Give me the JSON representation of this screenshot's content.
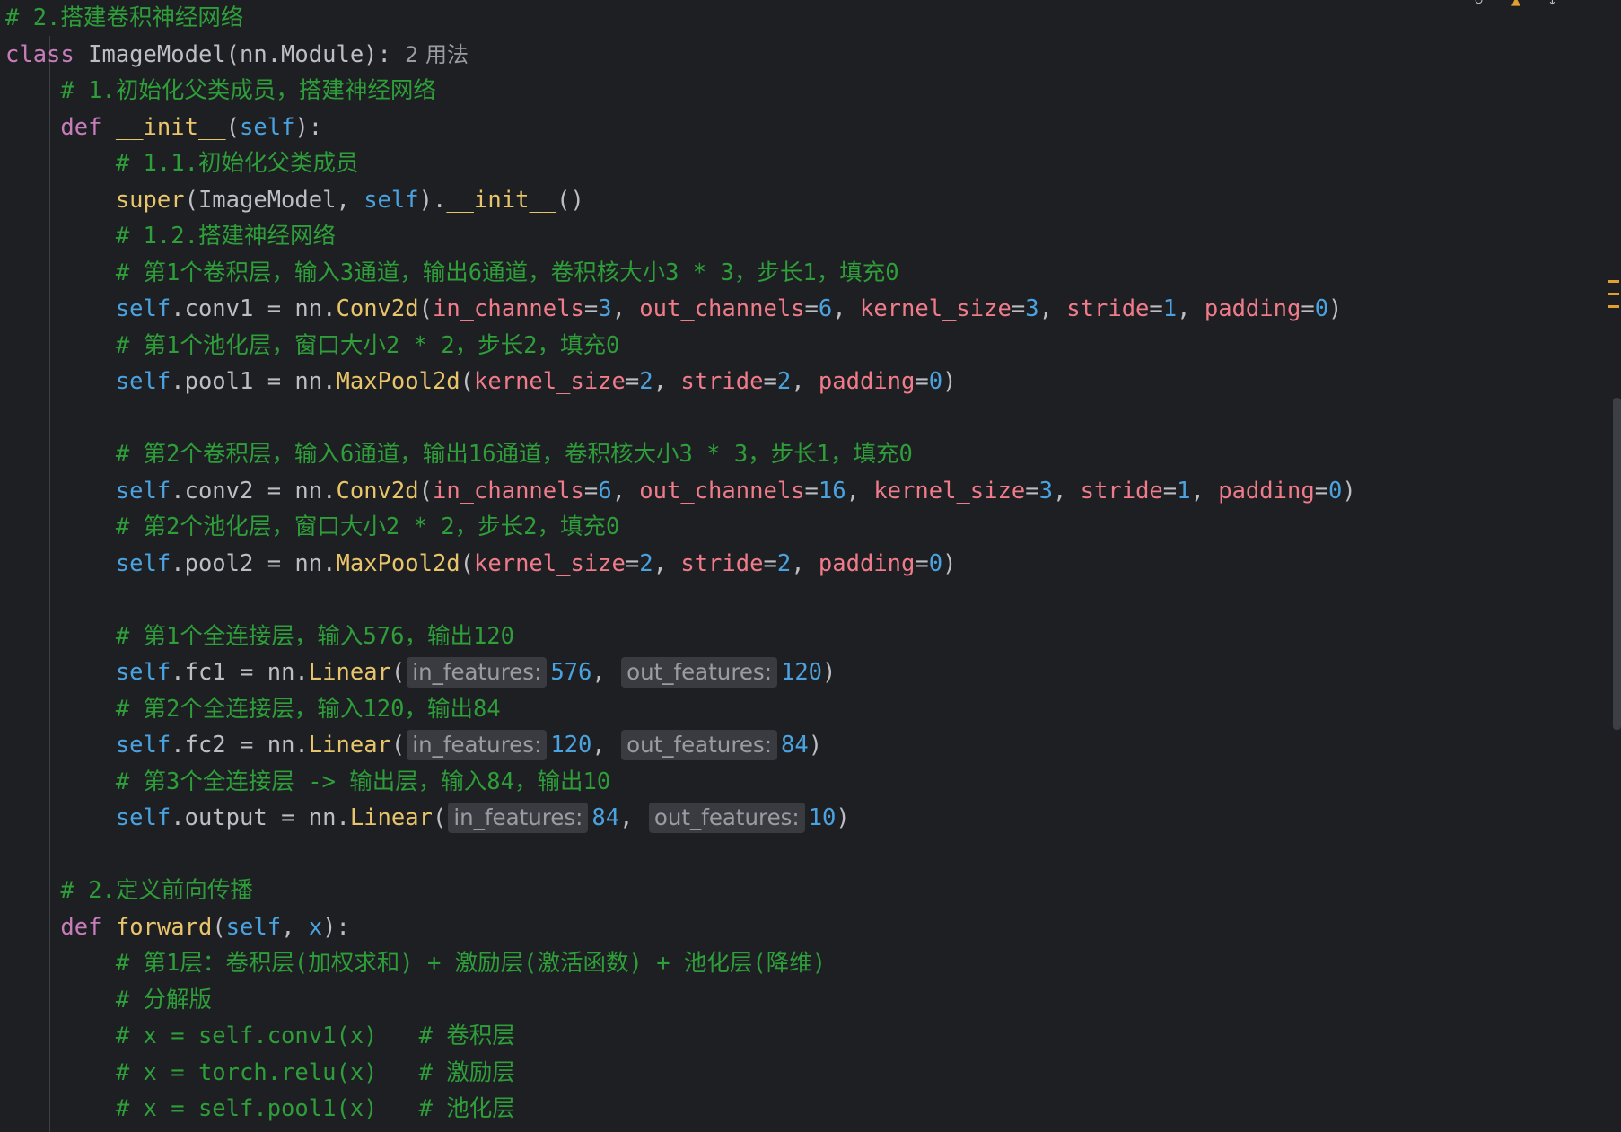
{
  "status_glyphs": {
    "reload": "↻",
    "warning": "▲",
    "arrows": "↕"
  },
  "lines": [
    [
      {
        "t": "# 2.搭建卷积神经网络",
        "c": "comment"
      }
    ],
    [
      {
        "t": "class ",
        "c": "kw-purple"
      },
      {
        "t": "ImageModel(nn.Module):"
      },
      {
        "t": "  2 用法",
        "c": "hint"
      }
    ],
    [
      {
        "t": "    "
      },
      {
        "t": "# 1.初始化父类成员，搭建神经网络",
        "c": "comment"
      }
    ],
    [
      {
        "t": "    "
      },
      {
        "t": "def ",
        "c": "kw-purple"
      },
      {
        "t": "__init__",
        "c": "fn"
      },
      {
        "t": "("
      },
      {
        "t": "self",
        "c": "self"
      },
      {
        "t": "):"
      }
    ],
    [
      {
        "t": "        "
      },
      {
        "t": "# 1.1.初始化父类成员",
        "c": "comment"
      }
    ],
    [
      {
        "t": "        "
      },
      {
        "t": "super",
        "c": "fn"
      },
      {
        "t": "(ImageModel, "
      },
      {
        "t": "self",
        "c": "self"
      },
      {
        "t": ")."
      },
      {
        "t": "__init__",
        "c": "fn"
      },
      {
        "t": "()"
      }
    ],
    [
      {
        "t": "        "
      },
      {
        "t": "# 1.2.搭建神经网络",
        "c": "comment"
      }
    ],
    [
      {
        "t": "        "
      },
      {
        "t": "# 第1个卷积层，输入3通道，输出6通道，卷积核大小3 * 3，步长1，填充0",
        "c": "comment"
      }
    ],
    [
      {
        "t": "        "
      },
      {
        "t": "self",
        "c": "self"
      },
      {
        "t": ".conv1 = nn."
      },
      {
        "t": "Conv2d",
        "c": "fn"
      },
      {
        "t": "("
      },
      {
        "t": "in_channels",
        "c": "param"
      },
      {
        "t": "="
      },
      {
        "t": "3",
        "c": "num"
      },
      {
        "t": ", "
      },
      {
        "t": "out_channels",
        "c": "param"
      },
      {
        "t": "="
      },
      {
        "t": "6",
        "c": "num"
      },
      {
        "t": ", "
      },
      {
        "t": "kernel_size",
        "c": "param"
      },
      {
        "t": "="
      },
      {
        "t": "3",
        "c": "num"
      },
      {
        "t": ", "
      },
      {
        "t": "stride",
        "c": "param"
      },
      {
        "t": "="
      },
      {
        "t": "1",
        "c": "num"
      },
      {
        "t": ", "
      },
      {
        "t": "padding",
        "c": "param"
      },
      {
        "t": "="
      },
      {
        "t": "0",
        "c": "num"
      },
      {
        "t": ")"
      }
    ],
    [
      {
        "t": "        "
      },
      {
        "t": "# 第1个池化层，窗口大小2 * 2，步长2，填充0",
        "c": "comment"
      }
    ],
    [
      {
        "t": "        "
      },
      {
        "t": "self",
        "c": "self"
      },
      {
        "t": ".pool1 = nn."
      },
      {
        "t": "MaxPool2d",
        "c": "fn"
      },
      {
        "t": "("
      },
      {
        "t": "kernel_size",
        "c": "param"
      },
      {
        "t": "="
      },
      {
        "t": "2",
        "c": "num"
      },
      {
        "t": ", "
      },
      {
        "t": "stride",
        "c": "param"
      },
      {
        "t": "="
      },
      {
        "t": "2",
        "c": "num"
      },
      {
        "t": ", "
      },
      {
        "t": "padding",
        "c": "param"
      },
      {
        "t": "="
      },
      {
        "t": "0",
        "c": "num"
      },
      {
        "t": ")"
      }
    ],
    [],
    [
      {
        "t": "        "
      },
      {
        "t": "# 第2个卷积层，输入6通道，输出16通道，卷积核大小3 * 3，步长1，填充0",
        "c": "comment"
      }
    ],
    [
      {
        "t": "        "
      },
      {
        "t": "self",
        "c": "self"
      },
      {
        "t": ".conv2 = nn."
      },
      {
        "t": "Conv2d",
        "c": "fn"
      },
      {
        "t": "("
      },
      {
        "t": "in_channels",
        "c": "param"
      },
      {
        "t": "="
      },
      {
        "t": "6",
        "c": "num"
      },
      {
        "t": ", "
      },
      {
        "t": "out_channels",
        "c": "param"
      },
      {
        "t": "="
      },
      {
        "t": "16",
        "c": "num"
      },
      {
        "t": ", "
      },
      {
        "t": "kernel_size",
        "c": "param"
      },
      {
        "t": "="
      },
      {
        "t": "3",
        "c": "num"
      },
      {
        "t": ", "
      },
      {
        "t": "stride",
        "c": "param"
      },
      {
        "t": "="
      },
      {
        "t": "1",
        "c": "num"
      },
      {
        "t": ", "
      },
      {
        "t": "padding",
        "c": "param"
      },
      {
        "t": "="
      },
      {
        "t": "0",
        "c": "num"
      },
      {
        "t": ")"
      }
    ],
    [
      {
        "t": "        "
      },
      {
        "t": "# 第2个池化层，窗口大小2 * 2，步长2，填充0",
        "c": "comment"
      }
    ],
    [
      {
        "t": "        "
      },
      {
        "t": "self",
        "c": "self"
      },
      {
        "t": ".pool2 = nn."
      },
      {
        "t": "MaxPool2d",
        "c": "fn"
      },
      {
        "t": "("
      },
      {
        "t": "kernel_size",
        "c": "param"
      },
      {
        "t": "="
      },
      {
        "t": "2",
        "c": "num"
      },
      {
        "t": ", "
      },
      {
        "t": "stride",
        "c": "param"
      },
      {
        "t": "="
      },
      {
        "t": "2",
        "c": "num"
      },
      {
        "t": ", "
      },
      {
        "t": "padding",
        "c": "param"
      },
      {
        "t": "="
      },
      {
        "t": "0",
        "c": "num"
      },
      {
        "t": ")"
      }
    ],
    [],
    [
      {
        "t": "        "
      },
      {
        "t": "# 第1个全连接层，输入576，输出120",
        "c": "comment"
      }
    ],
    [
      {
        "t": "        "
      },
      {
        "t": "self",
        "c": "self"
      },
      {
        "t": ".fc1 = nn."
      },
      {
        "t": "Linear",
        "c": "fn"
      },
      {
        "t": "("
      },
      {
        "t": "in_features:",
        "c": "inlay"
      },
      {
        "t": "576",
        "c": "num"
      },
      {
        "t": ", "
      },
      {
        "t": "out_features:",
        "c": "inlay"
      },
      {
        "t": "120",
        "c": "num"
      },
      {
        "t": ")"
      }
    ],
    [
      {
        "t": "        "
      },
      {
        "t": "# 第2个全连接层，输入120，输出84",
        "c": "comment"
      }
    ],
    [
      {
        "t": "        "
      },
      {
        "t": "self",
        "c": "self"
      },
      {
        "t": ".fc2 = nn."
      },
      {
        "t": "Linear",
        "c": "fn"
      },
      {
        "t": "("
      },
      {
        "t": "in_features:",
        "c": "inlay"
      },
      {
        "t": "120",
        "c": "num"
      },
      {
        "t": ", "
      },
      {
        "t": "out_features:",
        "c": "inlay"
      },
      {
        "t": "84",
        "c": "num"
      },
      {
        "t": ")"
      }
    ],
    [
      {
        "t": "        "
      },
      {
        "t": "# 第3个全连接层 -> 输出层，输入84，输出10",
        "c": "comment"
      }
    ],
    [
      {
        "t": "        "
      },
      {
        "t": "self",
        "c": "self"
      },
      {
        "t": ".output = nn."
      },
      {
        "t": "Linear",
        "c": "fn"
      },
      {
        "t": "("
      },
      {
        "t": "in_features:",
        "c": "inlay"
      },
      {
        "t": "84",
        "c": "num"
      },
      {
        "t": ", "
      },
      {
        "t": "out_features:",
        "c": "inlay"
      },
      {
        "t": "10",
        "c": "num"
      },
      {
        "t": ")"
      }
    ],
    [],
    [
      {
        "t": "    "
      },
      {
        "t": "# 2.定义前向传播",
        "c": "comment"
      }
    ],
    [
      {
        "t": "    "
      },
      {
        "t": "def ",
        "c": "kw-purple"
      },
      {
        "t": "forward",
        "c": "fn"
      },
      {
        "t": "("
      },
      {
        "t": "self",
        "c": "self"
      },
      {
        "t": ", "
      },
      {
        "t": "x",
        "c": "self"
      },
      {
        "t": "):"
      }
    ],
    [
      {
        "t": "        "
      },
      {
        "t": "# 第1层：卷积层(加权求和) + 激励层(激活函数) + 池化层(降维)",
        "c": "comment"
      }
    ],
    [
      {
        "t": "        "
      },
      {
        "t": "# 分解版",
        "c": "comment"
      }
    ],
    [
      {
        "t": "        "
      },
      {
        "t": "# x = self.conv1(x)   # 卷积层",
        "c": "comment"
      }
    ],
    [
      {
        "t": "        "
      },
      {
        "t": "# x = torch.relu(x)   # 激励层",
        "c": "comment"
      }
    ],
    [
      {
        "t": "        "
      },
      {
        "t": "# x = self.pool1(x)   # 池化层",
        "c": "comment"
      }
    ]
  ]
}
